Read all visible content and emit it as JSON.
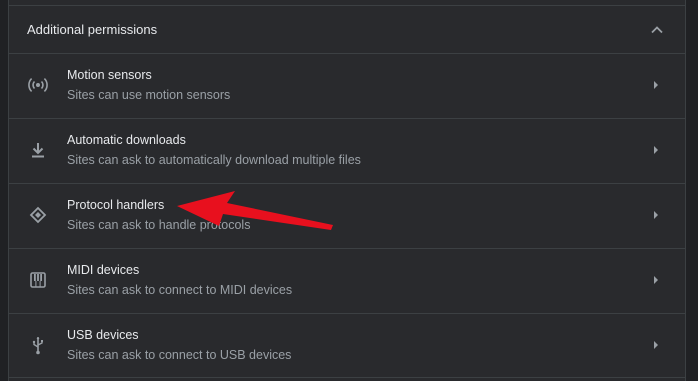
{
  "section": {
    "title": "Additional permissions",
    "expanded": true
  },
  "rows": [
    {
      "icon": "sensors-icon",
      "title": "Motion sensors",
      "description": "Sites can use motion sensors"
    },
    {
      "icon": "download-icon",
      "title": "Automatic downloads",
      "description": "Sites can ask to automatically download multiple files"
    },
    {
      "icon": "protocol-handler-icon",
      "title": "Protocol handlers",
      "description": "Sites can ask to handle protocols"
    },
    {
      "icon": "midi-piano-icon",
      "title": "MIDI devices",
      "description": "Sites can ask to connect to MIDI devices"
    },
    {
      "icon": "usb-icon",
      "title": "USB devices",
      "description": "Sites can ask to connect to USB devices"
    }
  ],
  "colors": {
    "background": "#202124",
    "card": "#292a2d",
    "divider": "#3c4043",
    "primary_text": "#e8eaed",
    "secondary_text": "#9aa0a6",
    "annotation": "#e8101e"
  }
}
